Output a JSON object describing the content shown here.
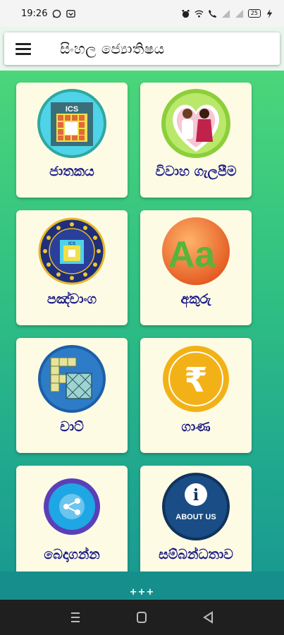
{
  "status": {
    "time": "19:26",
    "battery": "25"
  },
  "appbar": {
    "title": "සිංහල ජ්‍යොතිෂය"
  },
  "tiles": [
    {
      "label": "ජාතකය",
      "icon": "ics-chart-icon",
      "badge": "ICS"
    },
    {
      "label": "විවාහ ගැලපීම",
      "icon": "marriage-couple-icon"
    },
    {
      "label": "පඤ්චාංග",
      "icon": "zodiac-wheel-icon",
      "badge": "ICS"
    },
    {
      "label": "අකුරු",
      "icon": "letters-aa-icon",
      "badge": "Aa"
    },
    {
      "label": "චාට්",
      "icon": "chart-grid-icon"
    },
    {
      "label": "ගාණ",
      "icon": "rupee-icon",
      "badge": "₹"
    },
    {
      "label": "බෙදාගන්න",
      "icon": "share-icon"
    },
    {
      "label": "සම්බන්ධතාව",
      "icon": "about-us-icon",
      "badge": "ABOUT US"
    }
  ],
  "footer": {
    "more": "+++"
  },
  "colors": {
    "label": "#1a1a86",
    "tile_bg": "#fdfbe4"
  }
}
